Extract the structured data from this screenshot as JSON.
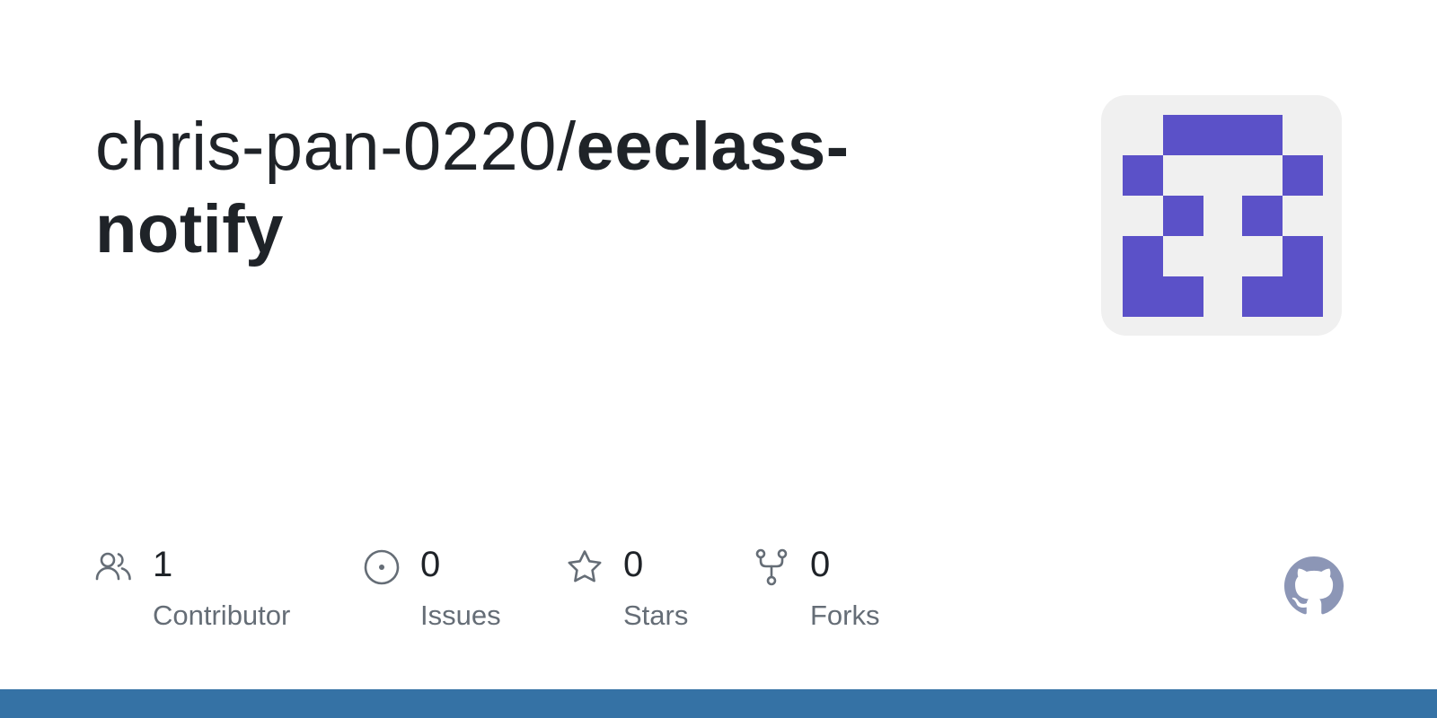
{
  "repo": {
    "owner": "chris-pan-0220/",
    "name": "eeclass-notify"
  },
  "stats": [
    {
      "icon": "people-icon",
      "count": "1",
      "label": "Contributor"
    },
    {
      "icon": "issue-icon",
      "count": "0",
      "label": "Issues"
    },
    {
      "icon": "star-icon",
      "count": "0",
      "label": "Stars"
    },
    {
      "icon": "fork-icon",
      "count": "0",
      "label": "Forks"
    }
  ],
  "colors": {
    "avatar_fg": "#5b51c8",
    "avatar_bg": "#f0f0f0",
    "language_bar": "#3572a5",
    "muted_text": "#656d76",
    "icon": "#656d76",
    "github_mark": "#8c96b6"
  },
  "icons": {
    "avatar": "identicon-avatar",
    "brand": "github-mark-icon"
  }
}
